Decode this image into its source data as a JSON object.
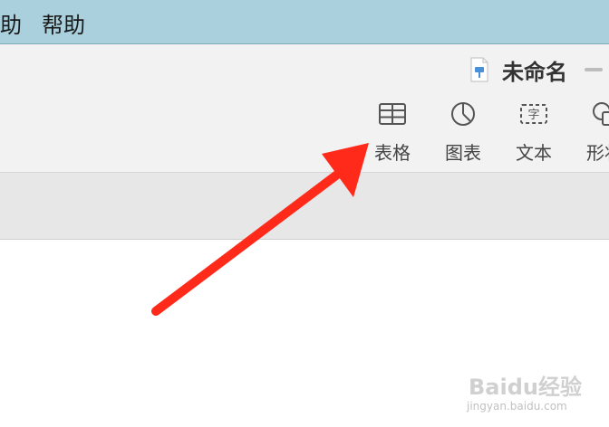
{
  "menubar": {
    "edge_item": "助",
    "help": "帮助"
  },
  "document": {
    "title": "未命名"
  },
  "toolbar": {
    "items": [
      {
        "label": "表格",
        "icon": "table-icon"
      },
      {
        "label": "图表",
        "icon": "chart-icon"
      },
      {
        "label": "文本",
        "icon": "text-icon"
      },
      {
        "label": "形状",
        "icon": "shape-icon"
      }
    ]
  },
  "annotation": {
    "arrow_color": "#ff2a1a"
  },
  "watermark": {
    "brand": "Baidu经验",
    "url": "jingyan.baidu.com"
  },
  "colors": {
    "menubar": "#a9d0dc",
    "toolbar": "#f2f2f2",
    "subbar": "#e7e7e7"
  }
}
